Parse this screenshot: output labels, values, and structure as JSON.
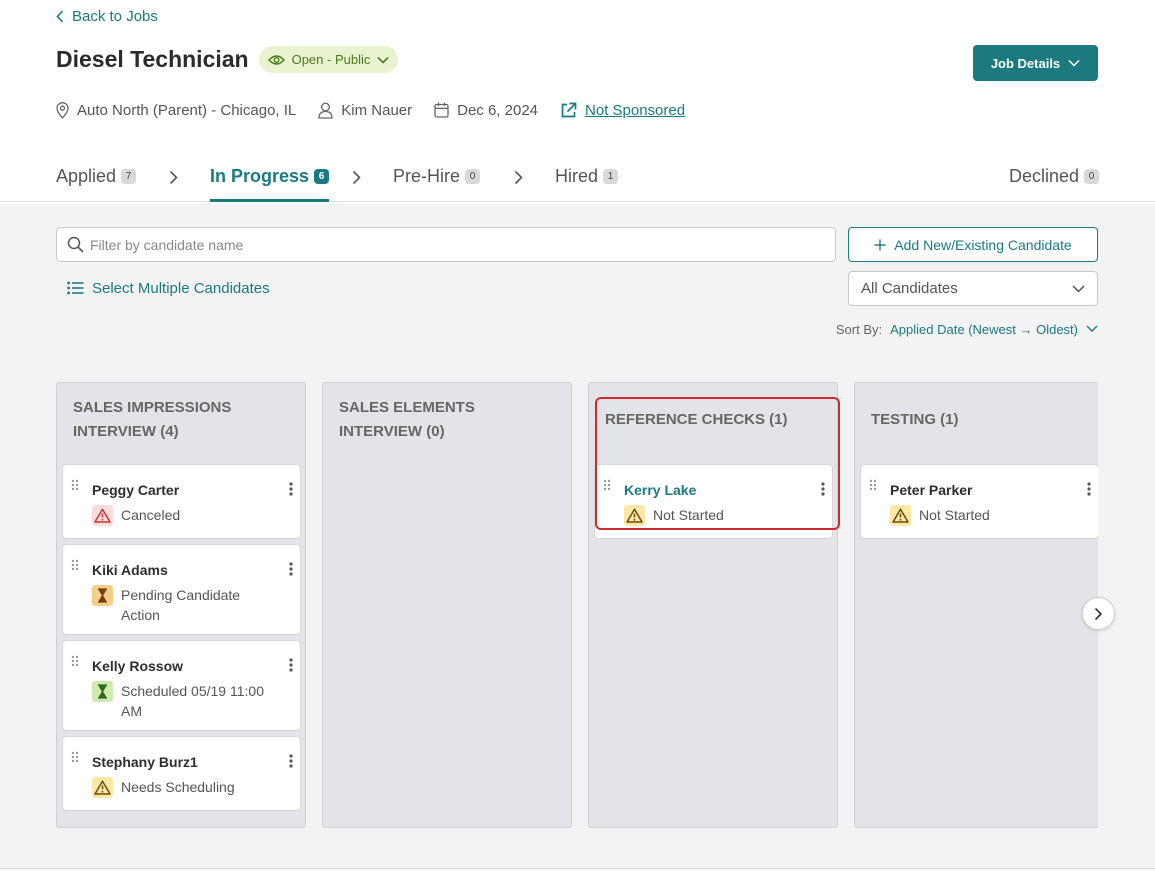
{
  "header": {
    "back_label": "Back to Jobs",
    "job_title": "Diesel Technician",
    "status": "Open - Public",
    "job_details_label": "Job Details",
    "location": "Auto North (Parent) - Chicago, IL",
    "recruiter": "Kim Nauer",
    "date": "Dec 6, 2024",
    "sponsorship": "Not Sponsored"
  },
  "tabs": [
    {
      "label": "Applied",
      "count": "7"
    },
    {
      "label": "In Progress",
      "count": "6",
      "active": true
    },
    {
      "label": "Pre-Hire",
      "count": "0"
    },
    {
      "label": "Hired",
      "count": "1"
    },
    {
      "label": "Declined",
      "count": "0"
    }
  ],
  "toolbar": {
    "search_placeholder": "Filter by candidate name",
    "add_label": "Add New/Existing Candidate",
    "select_multiple_label": "Select Multiple Candidates",
    "filter_value": "All Candidates",
    "sort_label": "Sort By:",
    "sort_value": "Applied Date (Newest → Oldest)"
  },
  "columns": [
    {
      "title": "SALES IMPRESSIONS INTERVIEW (4)",
      "cards": [
        {
          "name": "Peggy Carter",
          "status": "Canceled",
          "icon": "warning-icon"
        },
        {
          "name": "Kiki Adams",
          "status": "Pending Candidate Action",
          "icon": "hourglass-icon"
        },
        {
          "name": "Kelly Rossow",
          "status": "Scheduled 05/19 11:00 AM",
          "icon": "hourglass-icon"
        },
        {
          "name": "Stephany Burz1",
          "status": "Needs Scheduling",
          "icon": "warning-icon"
        }
      ]
    },
    {
      "title": "SALES ELEMENTS INTERVIEW (0)",
      "cards": []
    },
    {
      "title": "REFERENCE CHECKS (1)",
      "cards": [
        {
          "name": "Kerry Lake",
          "status": "Not Started",
          "icon": "warning-icon"
        }
      ]
    },
    {
      "title": "TESTING (1)",
      "cards": [
        {
          "name": "Peter Parker",
          "status": "Not Started",
          "icon": "warning-icon"
        }
      ]
    }
  ],
  "colors": {
    "accent": "#1a7a80",
    "status_pill_bg": "#e8f3cf",
    "canceled": "#f9dcdc",
    "warning": "#fbe8a6",
    "pending": "#f5cf8a",
    "scheduled": "#cfeab0",
    "highlight": "#cc2b2f"
  }
}
